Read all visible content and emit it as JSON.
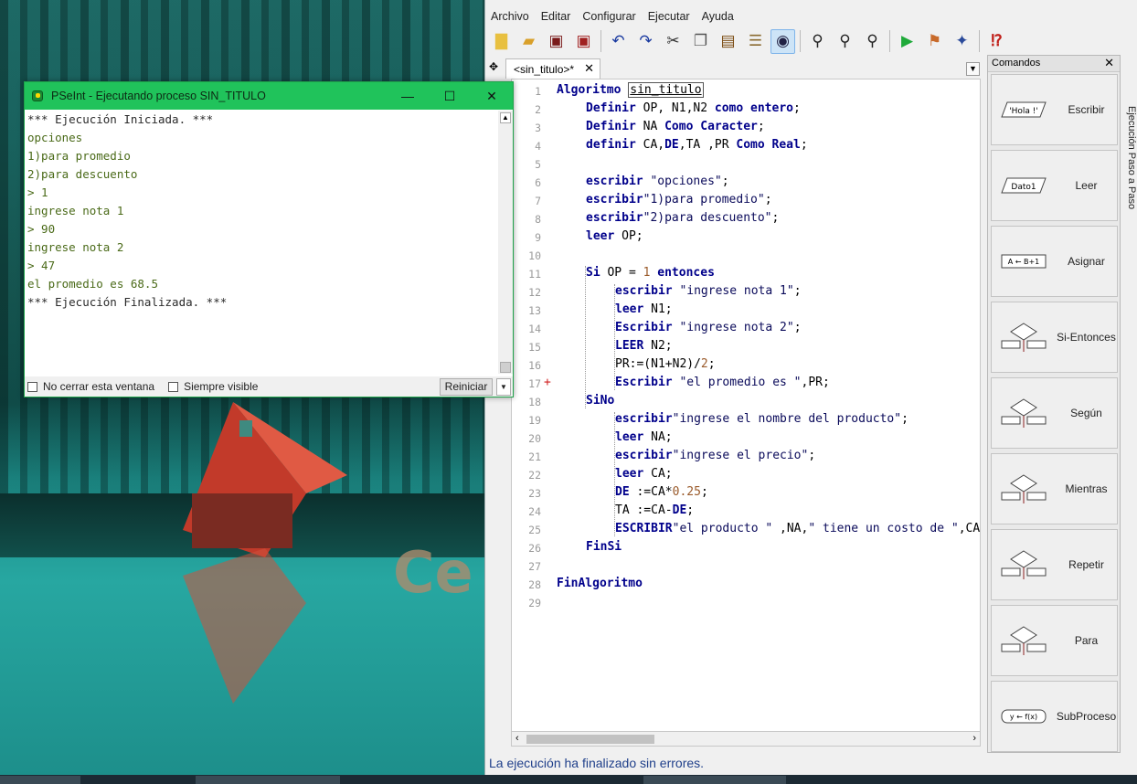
{
  "menu": [
    "Archivo",
    "Editar",
    "Configurar",
    "Ejecutar",
    "Ayuda"
  ],
  "toolbar_icons": [
    "new-file-icon",
    "open-folder-icon",
    "save-icon",
    "save-as-icon",
    "undo-icon",
    "redo-icon",
    "cut-icon",
    "copy-icon",
    "paste-icon",
    "edit-list-icon",
    "view-icon",
    "find-icon",
    "find-next-icon",
    "replace-icon",
    "run-icon",
    "step-run-icon",
    "debug-icon",
    "help-icon"
  ],
  "tab": {
    "label": "<sin_titulo>*",
    "close": "✕"
  },
  "code_lines": [
    {
      "n": "1",
      "text": "Algoritmo sin_titulo"
    },
    {
      "n": "2",
      "text": "Definir OP, N1,N2 como entero;"
    },
    {
      "n": "3",
      "text": "Definir NA Como Caracter;"
    },
    {
      "n": "4",
      "text": "definir CA,DE,TA ,PR Como Real;"
    },
    {
      "n": "5",
      "text": ""
    },
    {
      "n": "6",
      "text": "escribir \"opciones\";"
    },
    {
      "n": "7",
      "text": "escribir\"1)para promedio\";"
    },
    {
      "n": "8",
      "text": "escribir\"2)para descuento\";"
    },
    {
      "n": "9",
      "text": "leer OP;"
    },
    {
      "n": "10",
      "text": ""
    },
    {
      "n": "11",
      "text": "Si OP = 1 entonces"
    },
    {
      "n": "12",
      "text": "escribir \"ingrese nota 1\";"
    },
    {
      "n": "13",
      "text": "leer N1;"
    },
    {
      "n": "14",
      "text": "Escribir \"ingrese nota 2\";"
    },
    {
      "n": "15",
      "text": "LEER N2;"
    },
    {
      "n": "16",
      "text": "PR:=(N1+N2)/2;"
    },
    {
      "n": "17",
      "text": "Escribir \"el promedio es \",PR;"
    },
    {
      "n": "18",
      "text": "SiNo"
    },
    {
      "n": "19",
      "text": "escribir\"ingrese el nombre del producto\";"
    },
    {
      "n": "20",
      "text": "leer NA;"
    },
    {
      "n": "21",
      "text": "escribir\"ingrese el precio\";"
    },
    {
      "n": "22",
      "text": "leer CA;"
    },
    {
      "n": "23",
      "text": "DE :=CA*0.25;"
    },
    {
      "n": "24",
      "text": "TA :=CA-DE;"
    },
    {
      "n": "25",
      "text": "ESCRIBIR\"el producto \" ,NA,\" tiene un costo de \",CA,\" t:"
    },
    {
      "n": "26",
      "text": "FinSi"
    },
    {
      "n": "27",
      "text": ""
    },
    {
      "n": "28",
      "text": "FinAlgoritmo"
    },
    {
      "n": "29",
      "text": ""
    }
  ],
  "breakpoint_marker": "+",
  "status": "La ejecución ha finalizado sin errores.",
  "commands": {
    "title": "Comandos",
    "close": "✕",
    "items": [
      {
        "label": "Escribir",
        "icon_text": "'Hola !'"
      },
      {
        "label": "Leer",
        "icon_text": "Dato1"
      },
      {
        "label": "Asignar",
        "icon_text": "A ← B+1"
      },
      {
        "label": "Si-Entonces",
        "icon_text": ""
      },
      {
        "label": "Según",
        "icon_text": ""
      },
      {
        "label": "Mientras",
        "icon_text": ""
      },
      {
        "label": "Repetir",
        "icon_text": ""
      },
      {
        "label": "Para",
        "icon_text": ""
      },
      {
        "label": "SubProceso",
        "icon_text": "y ← f(x)"
      }
    ]
  },
  "side_tab": "Ejecución Paso a Paso",
  "console": {
    "title": "PSeInt - Ejecutando proceso SIN_TITULO",
    "lines": [
      {
        "t": "*** Ejecución Iniciada. ***",
        "c": "wh"
      },
      {
        "t": "opciones",
        "c": "g"
      },
      {
        "t": "1)para promedio",
        "c": "g"
      },
      {
        "t": "2)para descuento",
        "c": "g"
      },
      {
        "t": "> 1",
        "c": "g"
      },
      {
        "t": "ingrese nota 1",
        "c": "g"
      },
      {
        "t": "> 90",
        "c": "g"
      },
      {
        "t": "ingrese nota 2",
        "c": "g"
      },
      {
        "t": "> 47",
        "c": "g"
      },
      {
        "t": "el promedio es 68.5",
        "c": "g"
      },
      {
        "t": "*** Ejecución Finalizada. ***",
        "c": "wh"
      }
    ],
    "no_cerrar": "No cerrar esta ventana",
    "siempre_visible": "Siempre visible",
    "reiniciar": "Reiniciar"
  }
}
